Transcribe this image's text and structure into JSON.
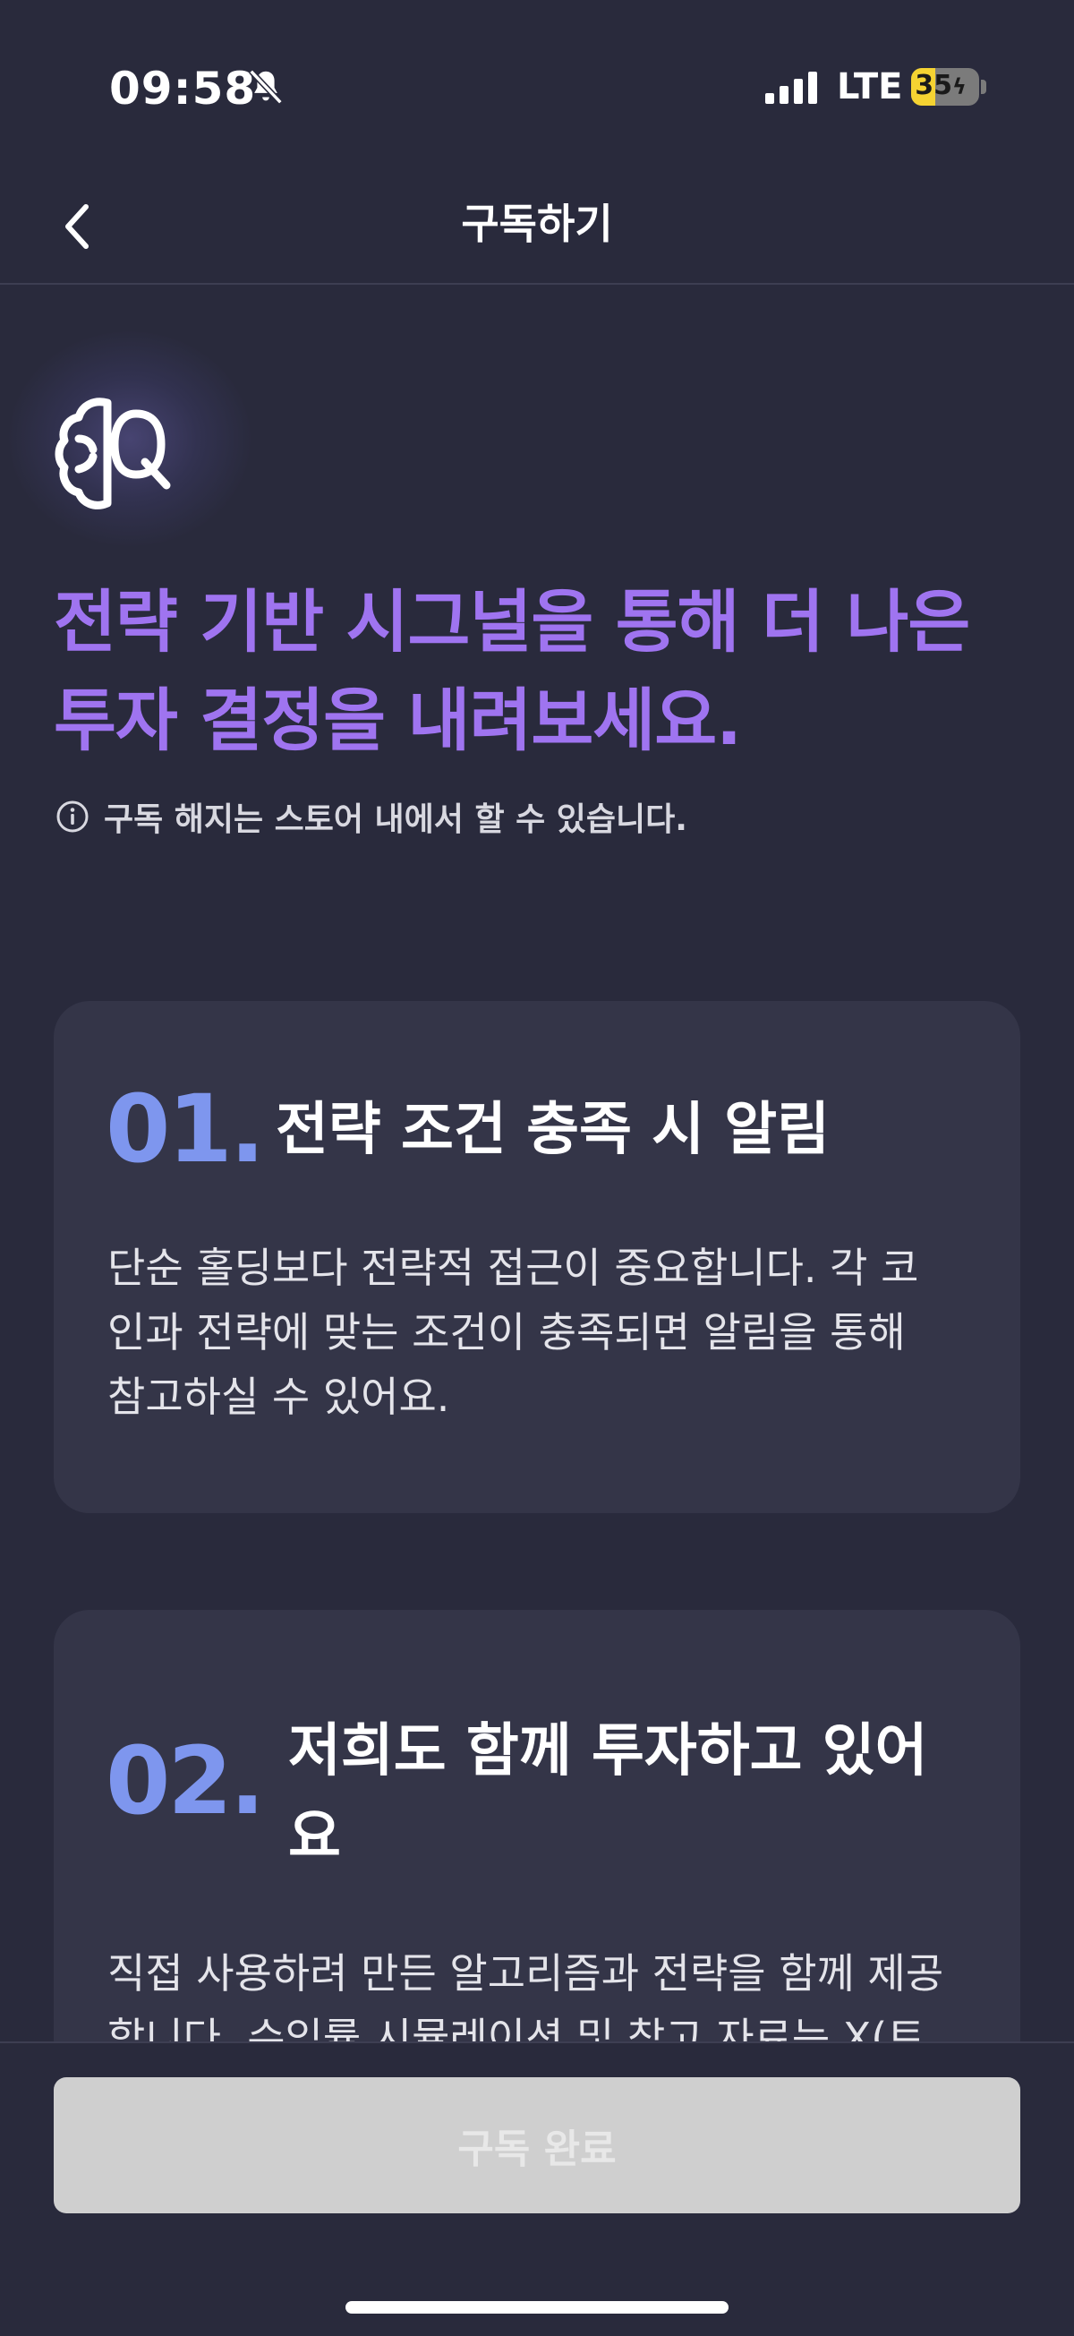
{
  "status_bar": {
    "time": "09:58",
    "network": "LTE",
    "battery_level": "35",
    "battery_fraction": 0.35,
    "silent_icon": "bell-off-icon",
    "signal_icon": "cellular-signal-icon",
    "charging_icon": "bolt-icon"
  },
  "nav": {
    "title": "구독하기",
    "back_icon": "chevron-left-icon"
  },
  "hero": {
    "logo_icon": "brain-q-logo-icon",
    "headline_line1": "전략 기반 시그널을 통해 더 나은",
    "headline_line2": "투자 결정을 내려보세요.",
    "headline_color": "#9f74f0",
    "notice_icon": "info-icon",
    "notice": "구독 해지는 스토어 내에서 할 수 있습니다."
  },
  "features": [
    {
      "number": "01.",
      "title": "전략 조건 충족 시 알림",
      "body_lines": [
        "단순 홀딩보다 전략적 접근이 중요합니다. 각 코",
        "인과 전략에 맞는 조건이 충족되면 알림을 통해",
        "참고하실 수 있어요."
      ]
    },
    {
      "number": "02.",
      "title_lines": [
        "저희도 함께 투자하고 있어",
        "요"
      ],
      "body_lines": [
        "직접 사용하려 만든 알고리즘과 전략을 함께 제공",
        "합니다. 수익률 시뮬레이션 및 참고 자료는 X(트"
      ]
    }
  ],
  "cta": {
    "label": "구독 완료"
  },
  "colors": {
    "background": "#292a3c",
    "card": "#343548",
    "number_accent": "#7e96ee",
    "button_disabled": "#cfcfcf"
  }
}
